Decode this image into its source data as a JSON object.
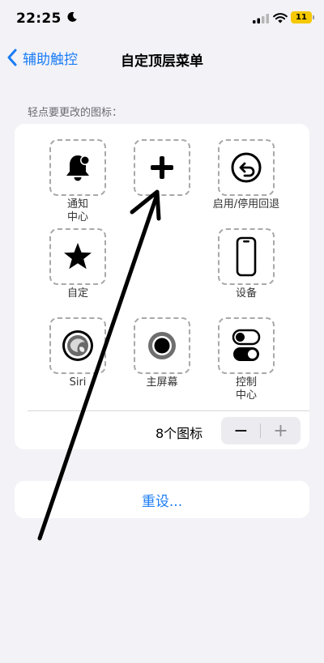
{
  "status_bar": {
    "time": "22:25",
    "battery": "11"
  },
  "nav": {
    "back_label": "辅助触控",
    "title": "自定顶层菜单"
  },
  "section_hint": "轻点要更改的图标：",
  "slots": [
    {
      "label": "通知\n中心",
      "icon": "bell-icon"
    },
    {
      "label": "",
      "icon": "add-icon"
    },
    {
      "label": "启用/停用回退",
      "icon": "undo-icon"
    },
    {
      "label": "自定",
      "icon": "star-icon"
    },
    {
      "label": "设备",
      "icon": "iphone-icon"
    },
    {
      "label": "Siri",
      "icon": "siri-icon"
    },
    {
      "label": "主屏幕",
      "icon": "home-button-icon"
    },
    {
      "label": "控制\n中心",
      "icon": "toggle-icon"
    }
  ],
  "icon_count_label": "8个图标",
  "stepper": {
    "minus": "−",
    "plus": "+"
  },
  "reset_label": "重设...",
  "colors": {
    "accent": "#1a7cf5",
    "battery": "#f6c800",
    "background": "#f2f2f7"
  }
}
